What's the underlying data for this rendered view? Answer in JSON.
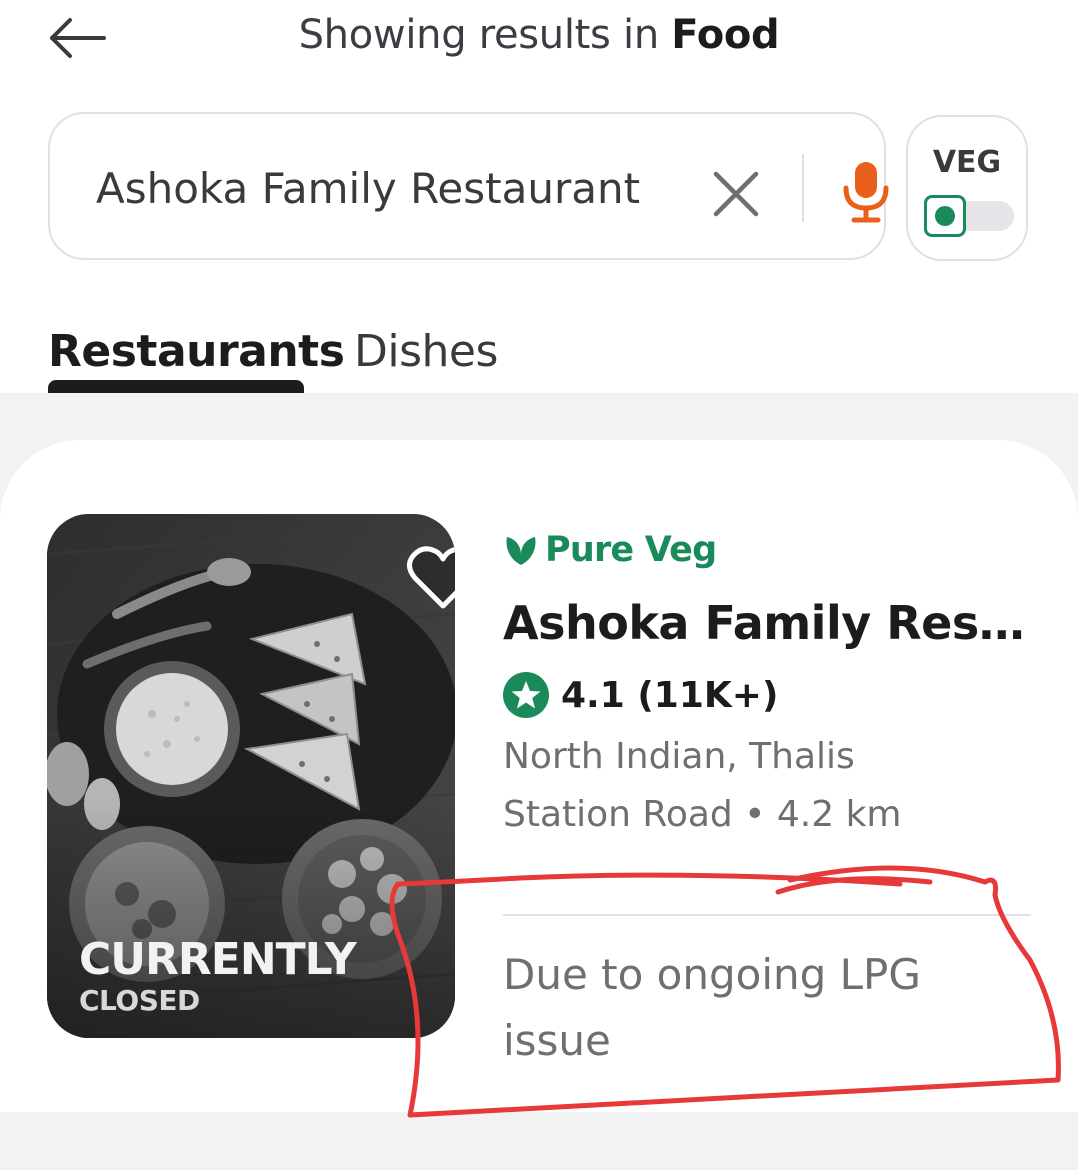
{
  "header": {
    "title_prefix": "Showing results in ",
    "title_category": "Food",
    "back_icon": "arrow-left-icon"
  },
  "search": {
    "value": "Ashoka Family Restaurant",
    "clear_icon": "close-icon",
    "mic_icon": "microphone-icon",
    "mic_color": "#e8601c"
  },
  "veg_toggle": {
    "label": "VEG",
    "enabled": false,
    "accent": "#1a8a5a"
  },
  "tabs": [
    {
      "label": "Restaurants",
      "active": true
    },
    {
      "label": "Dishes",
      "active": false
    }
  ],
  "restaurant": {
    "badge": "Pure Veg",
    "name": "Ashoka Family Restaurant",
    "rating": "4.1",
    "rating_count": "(11K+)",
    "cuisines": "North Indian, Thalis",
    "location": "Station Road",
    "distance": "4.2 km",
    "status_line1": "CURRENTLY",
    "status_line2": "CLOSED",
    "closed_reason": "Due to ongoing LPG issue",
    "favorite_icon": "heart-outline-icon",
    "image_description_icon": "food-platter-image",
    "accent_color": "#1a8a5a"
  },
  "annotation": {
    "color": "#e8393a",
    "type": "hand-drawn-circle"
  }
}
